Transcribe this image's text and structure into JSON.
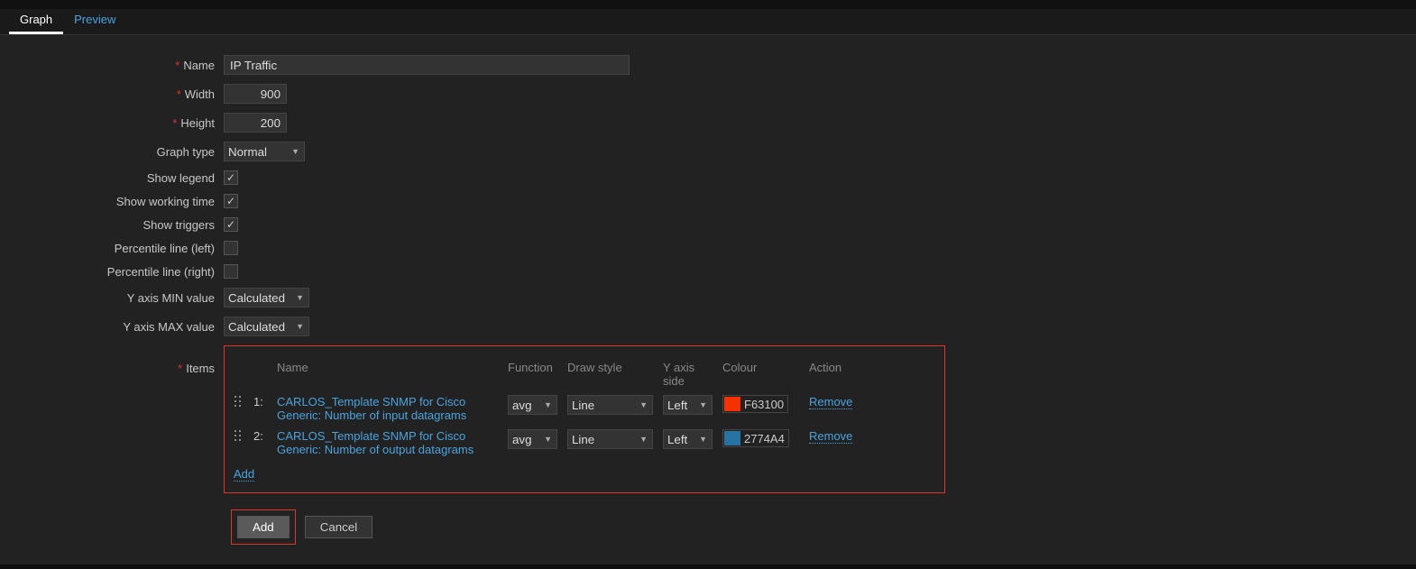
{
  "tabs": {
    "graph": "Graph",
    "preview": "Preview"
  },
  "labels": {
    "name": "Name",
    "width": "Width",
    "height": "Height",
    "graph_type": "Graph type",
    "show_legend": "Show legend",
    "show_working_time": "Show working time",
    "show_triggers": "Show triggers",
    "percentile_left": "Percentile line (left)",
    "percentile_right": "Percentile line (right)",
    "yaxis_min": "Y axis MIN value",
    "yaxis_max": "Y axis MAX value",
    "items": "Items"
  },
  "values": {
    "name": "IP Traffic",
    "width": "900",
    "height": "200",
    "graph_type": "Normal",
    "yaxis_min": "Calculated",
    "yaxis_max": "Calculated"
  },
  "checkboxes": {
    "show_legend": true,
    "show_working_time": true,
    "show_triggers": true,
    "percentile_left": false,
    "percentile_right": false
  },
  "items_header": {
    "name": "Name",
    "function": "Function",
    "draw_style": "Draw style",
    "y_axis_side": "Y axis side",
    "colour": "Colour",
    "action": "Action"
  },
  "items": [
    {
      "idx": "1:",
      "name": "CARLOS_Template SNMP for Cisco Generic: Number of input datagrams",
      "function": "avg",
      "draw_style": "Line",
      "y_axis_side": "Left",
      "colour_hex": "F63100",
      "colour_swatch": "#F63100",
      "action": "Remove"
    },
    {
      "idx": "2:",
      "name": "CARLOS_Template SNMP for Cisco Generic: Number of output datagrams",
      "function": "avg",
      "draw_style": "Line",
      "y_axis_side": "Left",
      "colour_hex": "2774A4",
      "colour_swatch": "#2774A4",
      "action": "Remove"
    }
  ],
  "items_add": "Add",
  "buttons": {
    "add": "Add",
    "cancel": "Cancel"
  }
}
